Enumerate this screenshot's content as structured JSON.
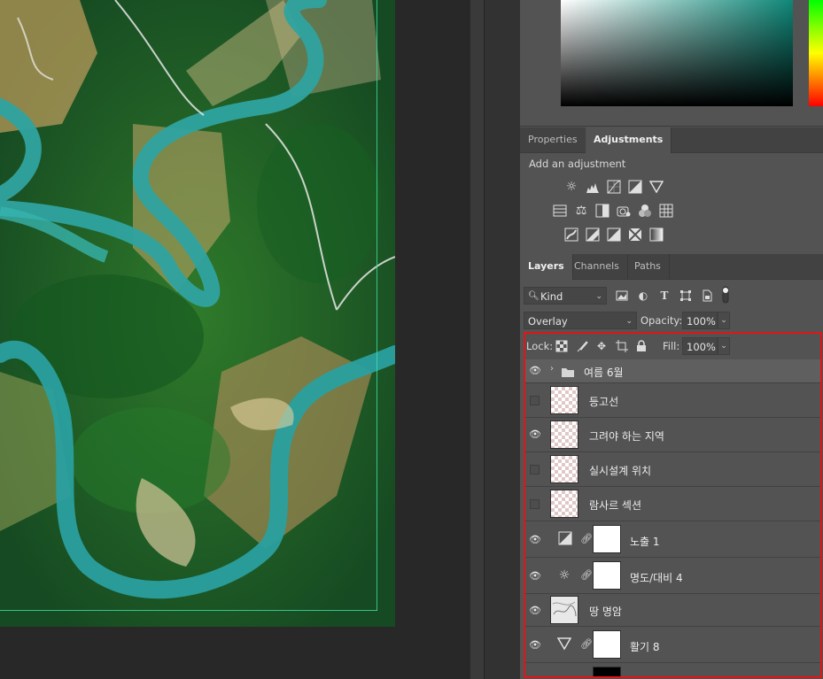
{
  "panels": {
    "adjustments_tabs": [
      "Properties",
      "Adjustments"
    ],
    "adjustments_active": "Adjustments",
    "adjustments_title": "Add an adjustment",
    "adjustment_icons": {
      "row1": [
        "brightness-contrast-icon",
        "levels-icon",
        "curves-icon",
        "exposure-icon",
        "vibrance-icon"
      ],
      "row2": [
        "hue-saturation-icon",
        "color-balance-icon",
        "black-white-icon",
        "photo-filter-icon",
        "channel-mixer-icon",
        "color-lookup-icon"
      ],
      "row3": [
        "invert-icon",
        "posterize-icon",
        "threshold-icon",
        "selective-color-icon",
        "gradient-map-icon"
      ]
    },
    "layers_tabs": [
      "Layers",
      "Channels",
      "Paths"
    ],
    "layers_active": "Layers"
  },
  "layers_panel": {
    "filter_kind": "Kind",
    "blend_mode": "Overlay",
    "opacity_label": "Opacity:",
    "opacity_value": "100%",
    "lock_label": "Lock:",
    "fill_label": "Fill:",
    "fill_value": "100%",
    "layers": [
      {
        "name": "여름 6월",
        "type": "group",
        "visible": true
      },
      {
        "name": "등고선",
        "type": "pixel",
        "visible": false
      },
      {
        "name": "그려야 하는 지역",
        "type": "pixel",
        "visible": true
      },
      {
        "name": "실시설계 위치",
        "type": "pixel",
        "visible": false
      },
      {
        "name": "람사르 섹션",
        "type": "pixel",
        "visible": false
      },
      {
        "name": "노출 1",
        "type": "adjustment",
        "icon": "exposure-icon",
        "visible": true
      },
      {
        "name": "명도/대비 4",
        "type": "adjustment",
        "icon": "brightness-contrast-icon",
        "visible": true
      },
      {
        "name": "땅 명암",
        "type": "pixel",
        "visible": true
      },
      {
        "name": "활기 8",
        "type": "adjustment",
        "icon": "vibrance-icon",
        "visible": true
      }
    ]
  },
  "colors": {
    "panel_bg": "#535353",
    "highlight": "#e01515",
    "guide": "#3fe0a8"
  }
}
